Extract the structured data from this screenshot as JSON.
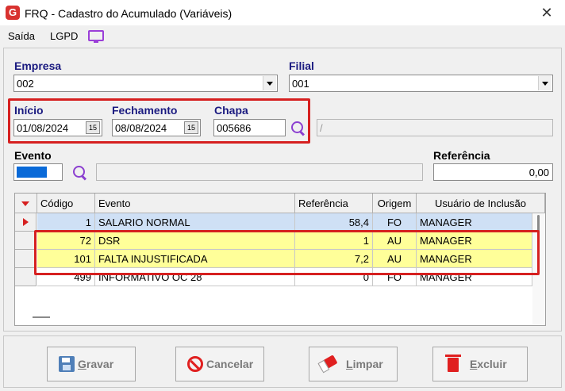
{
  "window": {
    "title": "FRQ - Cadastro do Acumulado (Variáveis)",
    "logo_letter": "G",
    "close_glyph": "✕"
  },
  "menu": {
    "items": [
      "Saída",
      "LGPD"
    ]
  },
  "form": {
    "empresa": {
      "label": "Empresa",
      "value": "002"
    },
    "filial": {
      "label": "Filial",
      "value": "001"
    },
    "inicio": {
      "label": "Início",
      "value": "01/08/2024",
      "cal_label": "15"
    },
    "fechamento": {
      "label": "Fechamento",
      "value": "08/08/2024",
      "cal_label": "15"
    },
    "chapa": {
      "label": "Chapa",
      "value": "005686",
      "name_value": "/"
    },
    "evento": {
      "label": "Evento",
      "description": ""
    },
    "referencia": {
      "label": "Referência",
      "value": "0,00"
    }
  },
  "grid": {
    "headers": [
      "Código",
      "Evento",
      "Referência",
      "Origem",
      "Usuário de Inclusão"
    ],
    "rows": [
      {
        "codigo": "1",
        "evento": "SALARIO NORMAL",
        "referencia": "58,4",
        "origem": "FO",
        "usuario": "MANAGER"
      },
      {
        "codigo": "72",
        "evento": "DSR",
        "referencia": "1",
        "origem": "AU",
        "usuario": "MANAGER"
      },
      {
        "codigo": "101",
        "evento": "FALTA INJUSTIFICADA",
        "referencia": "7,2",
        "origem": "AU",
        "usuario": "MANAGER"
      },
      {
        "codigo": "499",
        "evento": "INFORMATIVO OC 28",
        "referencia": "0",
        "origem": "FO",
        "usuario": "MANAGER"
      }
    ]
  },
  "buttons": {
    "gravar": {
      "first": "G",
      "rest": "ravar"
    },
    "cancelar": {
      "first": "",
      "rest": "Cancelar"
    },
    "limpar": {
      "first": "L",
      "rest": "impar"
    },
    "excluir": {
      "first": "E",
      "rest": "xcluir"
    }
  },
  "colors": {
    "highlight_border": "#d62020",
    "highlight_fill": "#ffff99",
    "label_blue": "#1a1a80",
    "accent_purple": "#8b3fd0"
  }
}
